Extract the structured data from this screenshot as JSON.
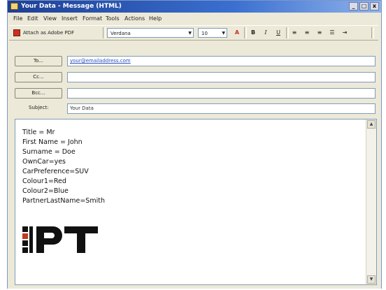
{
  "window": {
    "title": "Your Data - Message (HTML)",
    "controls": [
      "_",
      "□",
      "x"
    ]
  },
  "menu": [
    "File",
    "Edit",
    "View",
    "Insert",
    "Format",
    "Tools",
    "Actions",
    "Help"
  ],
  "toolbar": {
    "attach_label": "Attach as Adobe PDF",
    "font_name": "Verdana",
    "font_size": "10"
  },
  "fields": {
    "to_label": "To...",
    "to_value": "your@emailaddress.com",
    "cc_label": "Cc...",
    "cc_value": "",
    "bcc_label": "Bcc...",
    "bcc_value": "",
    "subject_label": "Subject:",
    "subject_value": "Your Data"
  },
  "body_lines": [
    "Title = Mr",
    "First Name = John",
    "Surname = Doe",
    "OwnCar=yes",
    "CarPreference=SUV",
    "Colour1=Red",
    "Colour2=Blue",
    "PartnerLastName=Smith"
  ],
  "logo_text": "PT",
  "icons": {
    "app": "envelope-icon",
    "attach": "pdf-icon",
    "font_color": "font-color-icon",
    "bold": "bold-icon",
    "italic": "italic-icon",
    "underline": "underline-icon"
  }
}
